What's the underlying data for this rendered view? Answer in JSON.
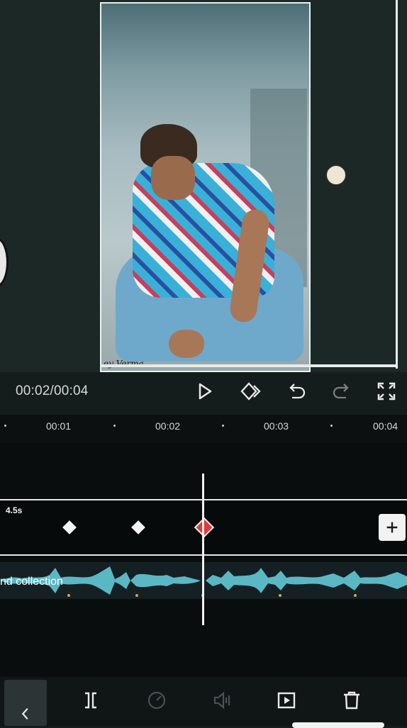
{
  "player": {
    "current_time": "00:02",
    "total_time": "00:04",
    "time_display": "00:02/00:04",
    "watermark": "ey Verma"
  },
  "ruler": {
    "ticks": [
      "00:01",
      "00:02",
      "00:03",
      "00:04"
    ]
  },
  "keyframe_track": {
    "duration": "4.5s",
    "add_label": "+"
  },
  "audio_track": {
    "label": "nd collection"
  },
  "icons": {
    "play": "play-icon",
    "keyframe": "keyframe-icon",
    "undo": "undo-icon",
    "redo": "redo-icon",
    "fullscreen": "fullscreen-icon",
    "back": "chevron-left-icon",
    "split": "split-icon",
    "speed": "speed-icon",
    "volume": "volume-icon",
    "animation": "animation-icon",
    "delete": "trash-icon"
  },
  "colors": {
    "background": "#141d1b",
    "timeline": "#0a0d0e",
    "waveform": "#5ab8c4",
    "keyframe_active": "#e03a3a",
    "beat_marker": "#d8a646"
  }
}
